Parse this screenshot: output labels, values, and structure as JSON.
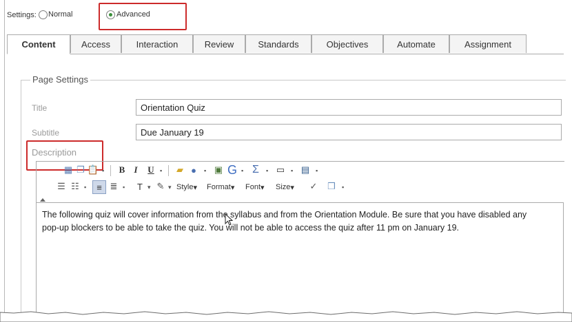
{
  "settings": {
    "label": "Settings:",
    "options": [
      {
        "label": "Normal",
        "selected": false
      },
      {
        "label": "Advanced",
        "selected": true
      }
    ]
  },
  "tabs": [
    {
      "label": "Content",
      "active": true
    },
    {
      "label": "Access"
    },
    {
      "label": "Interaction"
    },
    {
      "label": "Review"
    },
    {
      "label": "Standards"
    },
    {
      "label": "Objectives"
    },
    {
      "label": "Automate"
    },
    {
      "label": "Assignment"
    }
  ],
  "page_settings": {
    "legend": "Page Settings",
    "title_label": "Title",
    "title_value": "Orientation Quiz",
    "subtitle_label": "Subtitle",
    "subtitle_value": "Due January 19",
    "description_label": "Description"
  },
  "editor": {
    "toolbar": {
      "style_label": "Style",
      "format_label": "Format",
      "font_label": "Font",
      "size_label": "Size",
      "bold": "B",
      "italic": "I",
      "underline": "U",
      "sigma": "Σ",
      "g": "G"
    },
    "content": "The following quiz will cover information from the syllabus and from the Orientation Module.  Be sure that you have disabled any pop-up blockers to be able to take the quiz.  You will not be able to access the quiz after 11 pm on January 19."
  },
  "colors": {
    "highlight": "#cc2a2a",
    "radio_selected": "#3a8f3a"
  }
}
